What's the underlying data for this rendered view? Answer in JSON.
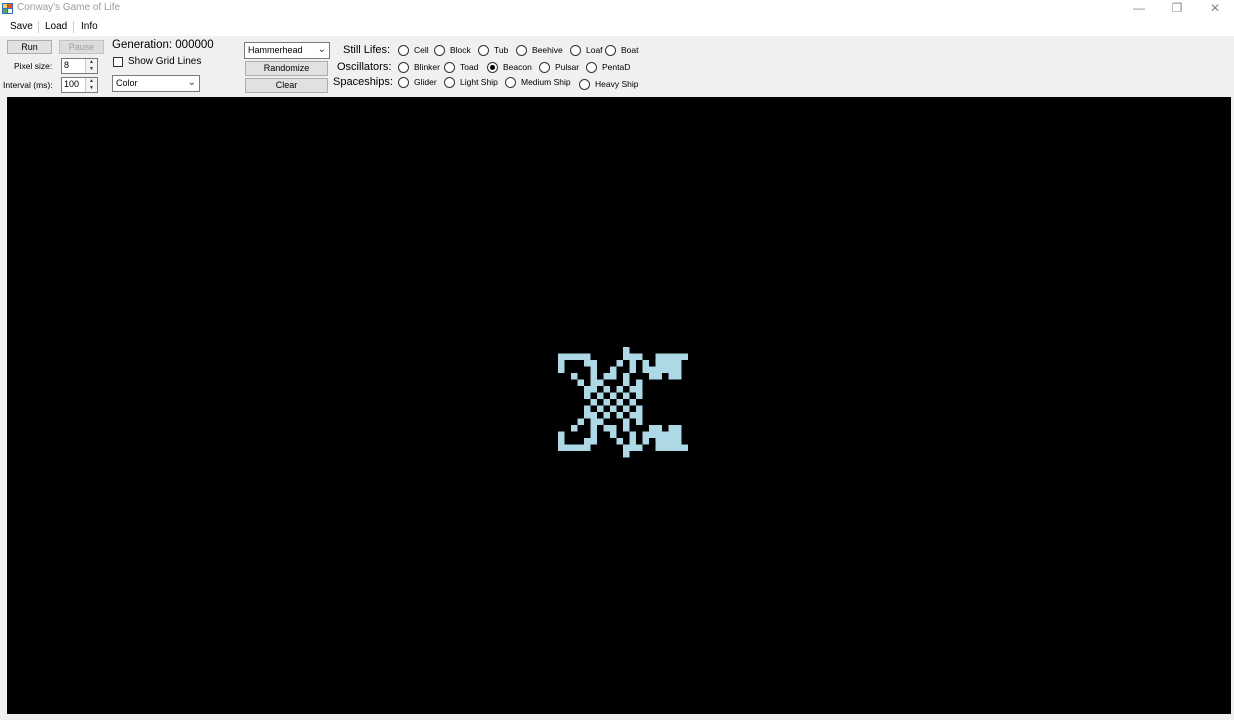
{
  "window": {
    "title": "Conway's Game of Life",
    "controls": {
      "minimize": "—",
      "restore": "❐",
      "close": "✕"
    }
  },
  "menu": {
    "save": "Save",
    "load": "Load",
    "info": "Info"
  },
  "controls": {
    "run_label": "Run",
    "pause_label": "Pause",
    "generation_label": "Generation: 000000",
    "pixel_size_label": "Pixel size:",
    "pixel_size_value": "8",
    "interval_label": "Interval (ms):",
    "interval_value": "100",
    "show_grid_lines_label": "Show Grid Lines",
    "show_grid_lines_checked": false,
    "color_mode": "Color",
    "pattern_selected": "Hammerhead",
    "randomize_label": "Randomize",
    "clear_label": "Clear"
  },
  "patterns": {
    "still_lifes": {
      "label": "Still Lifes:",
      "options": [
        "Cell",
        "Block",
        "Tub",
        "Beehive",
        "Loaf",
        "Boat"
      ]
    },
    "oscillators": {
      "label": "Oscillators:",
      "options": [
        "Blinker",
        "Toad",
        "Beacon",
        "Pulsar",
        "PentaD"
      ],
      "selected": "Beacon"
    },
    "spaceships": {
      "label": "Spaceships:",
      "options": [
        "Glider",
        "Light Ship",
        "Medium Ship",
        "Heavy Ship"
      ]
    }
  },
  "board": {
    "background_color": "#000000",
    "cell_color": "#add8e6",
    "pattern_rows": [
      "..........1.........",
      "11111.....111..11111",
      "1...11...1.1.1.1111",
      "1....1..1..1.111111",
      "..1..1.11.1...11.11",
      "...1.11...1.1...",
      "....11.1.1.11...",
      "....1.1.1.1.1...",
      ".....1.1.1.1....",
      "....1.1.1.1.1...",
      "....11.1.1.11...",
      "...1.11...1.1...",
      "..1..1.11.1...11.11",
      "1....1..1..1.111111",
      "1...11...1.1.1.1111",
      "11111.....111..11111",
      "..........1........."
    ]
  }
}
